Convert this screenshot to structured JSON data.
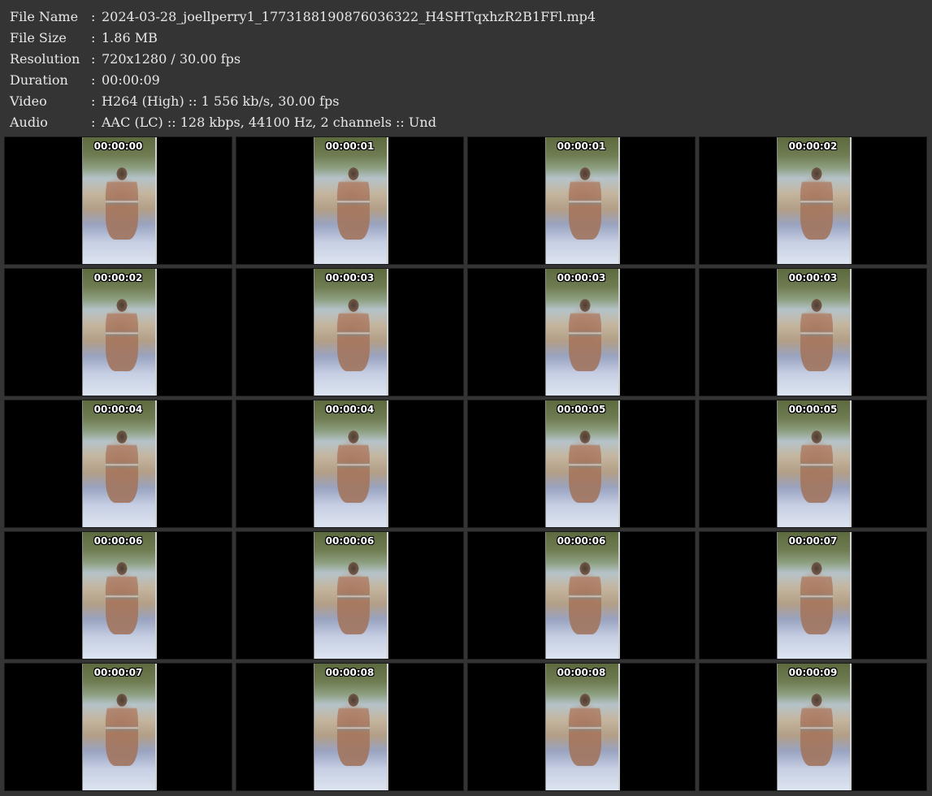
{
  "info": [
    {
      "label": "File Name",
      "value": "2024-03-28_joellperry1_1773188190876036322_H4SHTqxhzR2B1FFl.mp4"
    },
    {
      "label": "File Size",
      "value": "1.86 MB"
    },
    {
      "label": "Resolution",
      "value": "720x1280 / 30.00 fps"
    },
    {
      "label": "Duration",
      "value": "00:00:09"
    },
    {
      "label": "Video",
      "value": "H264 (High) :: 1 556 kb/s, 30.00 fps"
    },
    {
      "label": "Audio",
      "value": "AAC (LC) :: 128 kbps, 44100 Hz, 2 channels :: Und"
    }
  ],
  "separator": ":",
  "timestamps": [
    "00:00:00",
    "00:00:01",
    "00:00:01",
    "00:00:02",
    "00:00:02",
    "00:00:03",
    "00:00:03",
    "00:00:03",
    "00:00:04",
    "00:00:04",
    "00:00:05",
    "00:00:05",
    "00:00:06",
    "00:00:06",
    "00:00:06",
    "00:00:07",
    "00:00:07",
    "00:00:08",
    "00:00:08",
    "00:00:09"
  ]
}
